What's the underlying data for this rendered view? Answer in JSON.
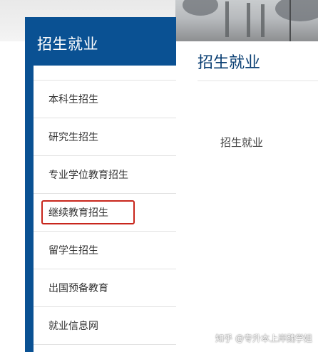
{
  "sidebar": {
    "title": "招生就业",
    "items": [
      {
        "label": "本科生招生"
      },
      {
        "label": "研究生招生"
      },
      {
        "label": "专业学位教育招生"
      },
      {
        "label": "继续教育招生",
        "highlighted": true
      },
      {
        "label": "留学生招生"
      },
      {
        "label": "出国预备教育"
      },
      {
        "label": "就业信息网"
      }
    ]
  },
  "main": {
    "title": "招生就业",
    "body_text": "招生就业"
  },
  "watermark": "知乎 @专升本上岸魏学姐",
  "colors": {
    "brand_blue": "#0a5193",
    "highlight_red": "#c8261c"
  }
}
